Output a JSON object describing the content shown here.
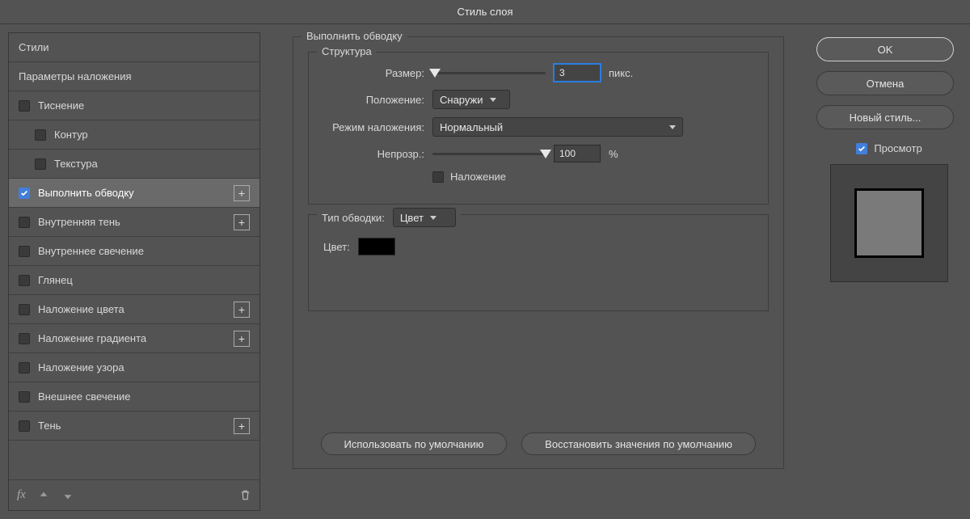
{
  "title": "Стиль слоя",
  "left": {
    "styles_header": "Стили",
    "blend_header": "Параметры наложения",
    "effects": [
      {
        "key": "bevel",
        "label": "Тиснение",
        "checked": false,
        "plus": false,
        "sub": false
      },
      {
        "key": "contour",
        "label": "Контур",
        "checked": false,
        "plus": false,
        "sub": true
      },
      {
        "key": "texture",
        "label": "Текстура",
        "checked": false,
        "plus": false,
        "sub": true
      },
      {
        "key": "stroke",
        "label": "Выполнить обводку",
        "checked": true,
        "plus": true,
        "sub": false,
        "selected": true
      },
      {
        "key": "ishadow",
        "label": "Внутренняя тень",
        "checked": false,
        "plus": true,
        "sub": false
      },
      {
        "key": "iglow",
        "label": "Внутреннее свечение",
        "checked": false,
        "plus": false,
        "sub": false
      },
      {
        "key": "satin",
        "label": "Глянец",
        "checked": false,
        "plus": false,
        "sub": false
      },
      {
        "key": "color",
        "label": "Наложение цвета",
        "checked": false,
        "plus": true,
        "sub": false
      },
      {
        "key": "grad",
        "label": "Наложение градиента",
        "checked": false,
        "plus": true,
        "sub": false
      },
      {
        "key": "pattern",
        "label": "Наложение узора",
        "checked": false,
        "plus": false,
        "sub": false
      },
      {
        "key": "oglow",
        "label": "Внешнее свечение",
        "checked": false,
        "plus": false,
        "sub": false
      },
      {
        "key": "dshadow",
        "label": "Тень",
        "checked": false,
        "plus": true,
        "sub": false
      }
    ],
    "fx_label": "fx"
  },
  "center": {
    "section_title": "Выполнить обводку",
    "structure_legend": "Структура",
    "size_label": "Размер:",
    "size_value": "3",
    "size_unit": "пикс.",
    "position_label": "Положение:",
    "position_value": "Снаружи",
    "blend_label": "Режим наложения:",
    "blend_value": "Нормальный",
    "opacity_label": "Непрозр.:",
    "opacity_value": "100",
    "opacity_unit": "%",
    "overprint_label": "Наложение",
    "filltype_label": "Тип обводки:",
    "filltype_value": "Цвет",
    "color_label": "Цвет:",
    "color_value": "#000000",
    "make_default": "Использовать по умолчанию",
    "reset_default": "Восстановить значения по умолчанию"
  },
  "right": {
    "ok": "OK",
    "cancel": "Отмена",
    "new_style": "Новый стиль...",
    "preview": "Просмотр"
  }
}
